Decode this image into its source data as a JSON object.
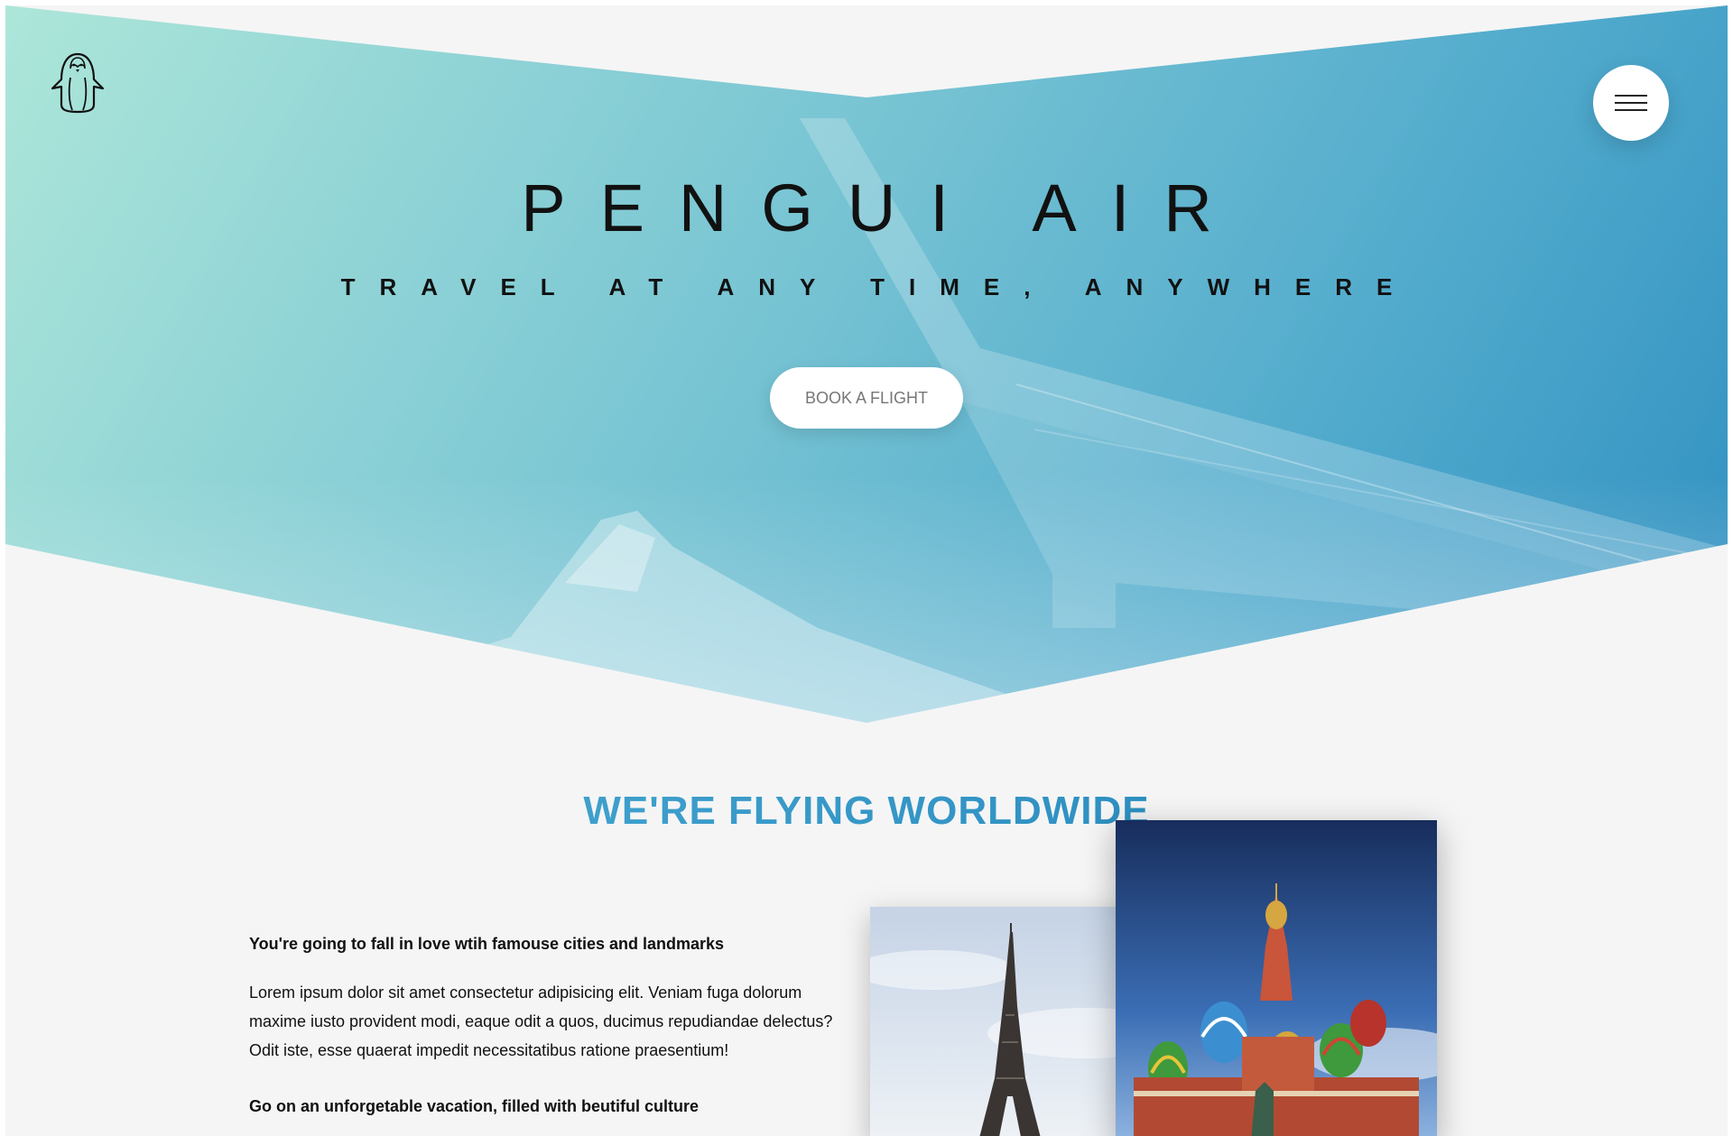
{
  "brand": {
    "logo_icon": "penguin-icon",
    "title": "PENGUI AIR",
    "tagline": "TRAVEL AT ANY TIME, ANYWHERE"
  },
  "nav": {
    "menu_icon": "hamburger-menu-icon"
  },
  "hero": {
    "cta_label": "BOOK A FLIGHT",
    "gradient_colors": [
      "#ade6d9",
      "#2f8fc0"
    ]
  },
  "features": {
    "section_title": "WE'RE FLYING WORLDWIDE",
    "items": [
      {
        "heading": "You're going to fall in love wtih famouse cities and landmarks",
        "body": "Lorem ipsum dolor sit amet consectetur adipisicing elit. Veniam fuga dolorum maxime iusto provident modi, eaque odit a quos, ducimus repudiandae delectus? Odit iste, esse quaerat impedit necessitatibus ratione praesentium!"
      },
      {
        "heading": "Go on an unforgetable vacation, filled with beutiful culture"
      }
    ],
    "photos": [
      {
        "subject": "eiffel-tower"
      },
      {
        "subject": "saint-basils-cathedral"
      }
    ]
  },
  "colors": {
    "accent_start": "#4fb0d8",
    "accent_end": "#1d7fb6",
    "background": "#f5f5f5"
  }
}
